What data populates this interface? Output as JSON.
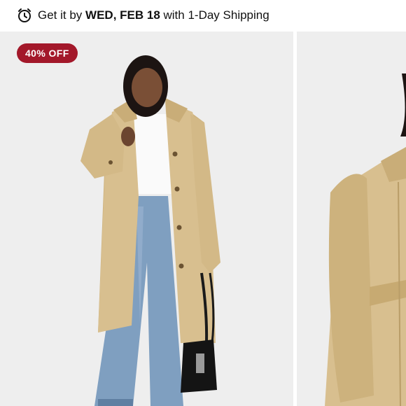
{
  "shipping": {
    "prefix": "Get it by ",
    "date": "WED, FEB 18",
    "suffix": " with 1-Day Shipping",
    "icon": "alarm-clock-icon"
  },
  "gallery": {
    "badge": "40% OFF",
    "badge_color": "#a3182a",
    "images": [
      {
        "alt": "Model wearing tan faux leather trench coat with white top, blue jeans and black bucket bag"
      },
      {
        "alt": "Side view of tan faux leather trench coat with belt"
      }
    ]
  },
  "colors": {
    "coat": "#d8bf8f",
    "background": "#eeeeee",
    "notification_dot": "#c8102e"
  }
}
